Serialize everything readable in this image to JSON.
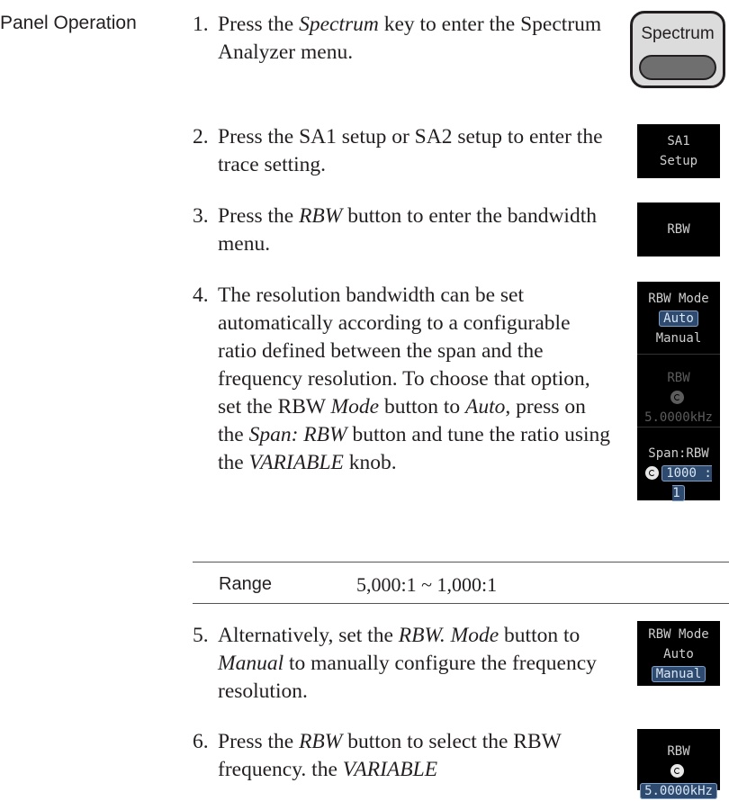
{
  "section_label": "Panel Operation",
  "steps": [
    {
      "num": "1.",
      "parts": [
        "Press the ",
        "Spectrum",
        " key to enter the Spectrum Analyzer menu."
      ]
    },
    {
      "num": "2.",
      "parts": [
        "Press the SA1 setup or SA2 setup to enter the trace setting."
      ]
    },
    {
      "num": "3.",
      "parts": [
        "Press the ",
        "RBW",
        " button to enter the bandwidth menu."
      ]
    },
    {
      "num": "4.",
      "parts": [
        "The resolution bandwidth can be set automatically according to a configurable ratio defined between the span and the frequency resolution. To choose that option, set the RBW ",
        "Mode",
        " button to ",
        "Auto",
        ", press on the ",
        "Span: RBW",
        " button and tune the ratio using the ",
        "VARIABLE",
        " knob."
      ]
    },
    {
      "num": "5.",
      "parts": [
        "Alternatively, set the ",
        "RBW. Mode",
        " button to ",
        "Manual",
        " to manually configure the frequency resolution."
      ]
    },
    {
      "num": "6.",
      "parts": [
        "Press the ",
        "RBW",
        " button to select the RBW frequency. the ",
        "VARIABLE"
      ]
    }
  ],
  "range": {
    "label": "Range",
    "value": "5,000:1 ~ 1,000:1"
  },
  "keys": {
    "spectrum": "Spectrum",
    "sa1_line1": "SA1",
    "sa1_line2": "Setup",
    "rbw": "RBW",
    "rbw_mode": "RBW Mode",
    "auto": "Auto",
    "manual": "Manual",
    "rbw_value": "5.0000kHz",
    "span_rbw": "Span:RBW",
    "ratio": "1000 : 1"
  }
}
